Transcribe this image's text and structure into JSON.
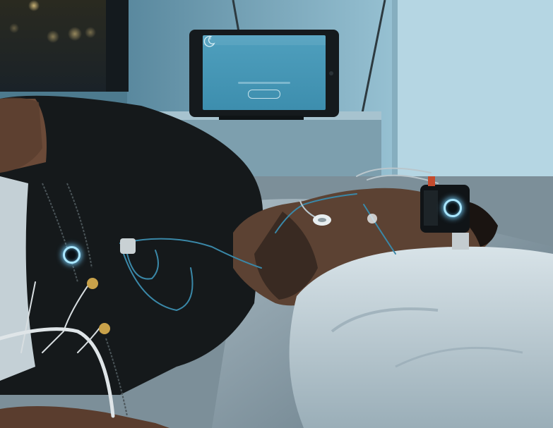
{
  "tablet": {
    "title": "",
    "time": "",
    "button_label": ""
  },
  "colors": {
    "room_dark": "#0d1418",
    "wall_blue": "#7fb0c6",
    "tablet_screen": "#4a9abb",
    "sensor_glow": "#a9e6ff",
    "shirt": "#15191b",
    "pillow": "#c9d6dc"
  },
  "icons": [
    "moon-icon",
    "close-icon"
  ]
}
